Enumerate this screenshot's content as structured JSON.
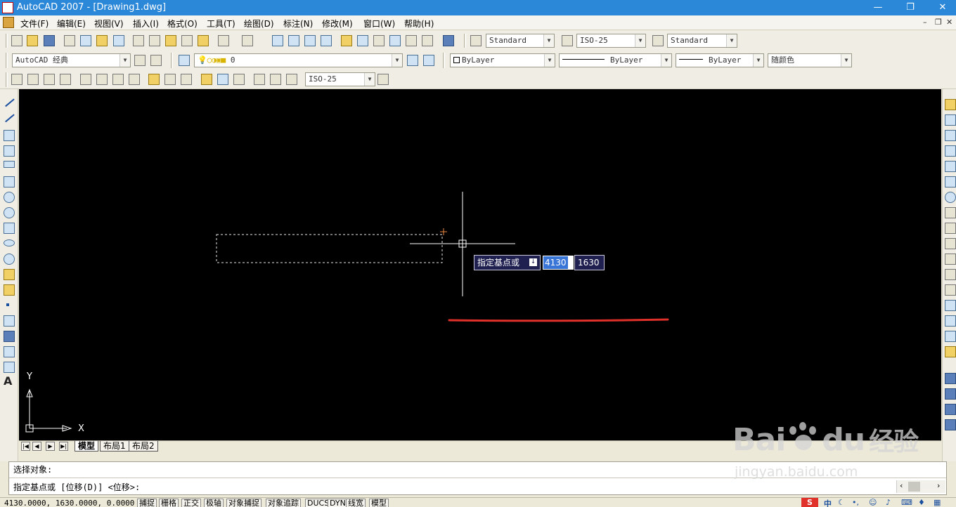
{
  "window": {
    "title": "AutoCAD 2007 - [Drawing1.dwg]",
    "minimize": "—",
    "restore": "❐",
    "close": "✕"
  },
  "menu": {
    "items": [
      {
        "label": "文件(F)"
      },
      {
        "label": "编辑(E)"
      },
      {
        "label": "视图(V)"
      },
      {
        "label": "插入(I)"
      },
      {
        "label": "格式(O)"
      },
      {
        "label": "工具(T)"
      },
      {
        "label": "绘图(D)"
      },
      {
        "label": "标注(N)"
      },
      {
        "label": "修改(M)"
      },
      {
        "label": "窗口(W)"
      },
      {
        "label": "帮助(H)"
      }
    ],
    "doc_minimize": "–",
    "doc_restore": "❐",
    "doc_close": "✕"
  },
  "toolbars": {
    "text_style": "Standard",
    "dim_style": "ISO-25",
    "table_style": "Standard",
    "workspace": "AutoCAD 经典",
    "layer": "0",
    "color": "ByLayer",
    "linetype": "ByLayer",
    "lineweight": "ByLayer",
    "plot_style": "随颜色",
    "dim_style_2": "ISO-25"
  },
  "drawing": {
    "dynamic_prompt": "指定基点或",
    "input_x": "4130",
    "input_y": "1630",
    "ucs_x": "X",
    "ucs_y": "Y",
    "colors": {
      "background": "#000000",
      "annotation_line": "#e0302a",
      "crosshair": "#ffffff",
      "input_box": "#1f2050"
    }
  },
  "layout_tabs": [
    {
      "label": "模型",
      "active": true
    },
    {
      "label": "布局1",
      "active": false
    },
    {
      "label": "布局2",
      "active": false
    }
  ],
  "command": {
    "line1": "选择对象:",
    "line2": "指定基点或 [位移(D)] <位移>:"
  },
  "status": {
    "coords": "4130.0000, 1630.0000, 0.0000",
    "buttons": [
      "捕捉",
      "栅格",
      "正交",
      "极轴",
      "对象捕捉",
      "对象追踪",
      "DUCS",
      "DYN",
      "线宽",
      "模型"
    ]
  },
  "watermark": {
    "brand": "Bai",
    "brand2": "du",
    "product": "经验",
    "url": "jingyan.baidu.com"
  },
  "tray": {
    "ime": "中",
    "icons": [
      "moon-icon",
      "punctuation-icon",
      "emoji-icon",
      "mic-icon",
      "keyboard-icon",
      "shirt-icon",
      "grid-icon"
    ]
  }
}
